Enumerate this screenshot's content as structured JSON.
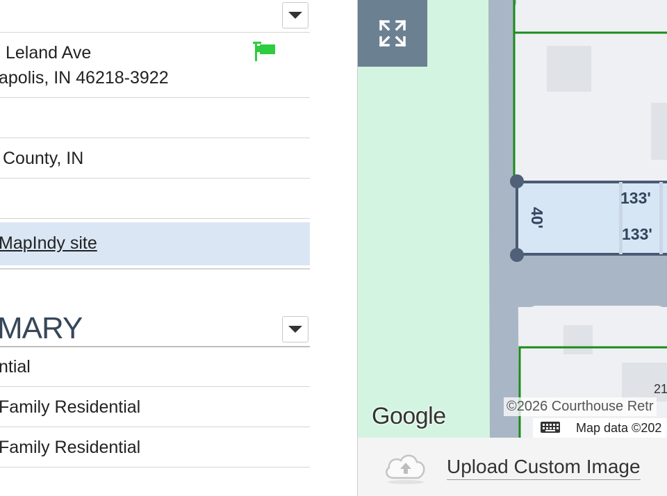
{
  "property": {
    "address_line1": "Leland Ave",
    "address_line2": "apolis, IN 46218-3922",
    "county": "County, IN",
    "link_label": "MapIndy site"
  },
  "summary": {
    "title": "MARY",
    "items": [
      "ntial",
      "Family Residential",
      "Family Residential"
    ]
  },
  "map": {
    "dimension_side": "40'",
    "dimension_top": "133'",
    "dimension_bottom": "133'",
    "parcel_number": "21",
    "attribution_courthouse": "©2026 Courthouse Retr",
    "attribution_map_data": "Map data ©202",
    "google_logo": "Google"
  },
  "upload": {
    "label": "Upload Custom Image"
  },
  "icons": {
    "flag": "flag-icon",
    "dropdown": "chevron-down-icon",
    "expand": "expand-icon",
    "keyboard": "keyboard-icon",
    "upload": "cloud-upload-icon"
  },
  "colors": {
    "flag": "#2ecc40",
    "highlight": "#dae6f4",
    "parcel_line": "#1a8c1a",
    "road": "#a9b6c5",
    "park": "#d3f4e0",
    "selected_parcel": "#d7e6f5"
  }
}
